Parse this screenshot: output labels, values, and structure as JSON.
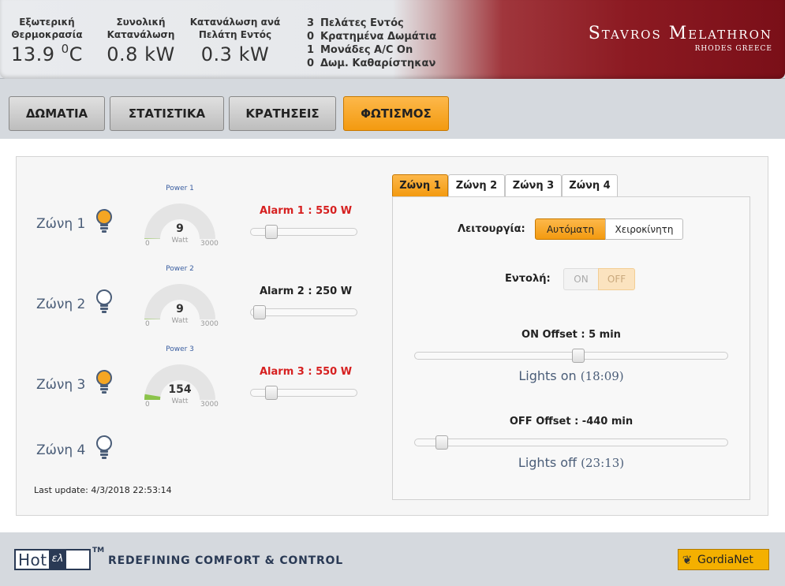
{
  "header": {
    "metrics": [
      {
        "label1": "Εξωτερική",
        "label2": "Θερμοκρασία",
        "value": "13.9 ",
        "sup": "0",
        "unit": "C"
      },
      {
        "label1": "Συνολική",
        "label2": "Κατανάλωση",
        "value": "0.8 kW"
      },
      {
        "label1": "Κατανάλωση ανά",
        "label2": "Πελάτη Εντός",
        "value": "0.3 kW"
      }
    ],
    "stats": [
      {
        "n": "3",
        "text": "Πελάτες Εντός"
      },
      {
        "n": "0",
        "text": "Κρατημένα Δωμάτια"
      },
      {
        "n": "1",
        "text": "Μονάδες A/C On"
      },
      {
        "n": "0",
        "text": "Δωμ. Καθαρίστηκαν"
      }
    ],
    "brand_name": "Stavros Melathron",
    "brand_sub": "RHODES GREECE"
  },
  "tabs": [
    "ΔΩΜΑΤΙΑ",
    "ΣΤΑΤΙΣΤΙΚΑ",
    "ΚΡΑΤΗΣΕΙΣ",
    "ΦΩΤΙΣΜΟΣ"
  ],
  "zones": [
    {
      "label": "Ζώνη 1",
      "lit": true,
      "gauge_title": "Power 1",
      "value": "9",
      "alarm": "Alarm 1 : 550 W",
      "alarm_red": true
    },
    {
      "label": "Ζώνη 2",
      "lit": false,
      "gauge_title": "Power 2",
      "value": "9",
      "alarm": "Alarm 2 : 250 W",
      "alarm_red": false
    },
    {
      "label": "Ζώνη 3",
      "lit": true,
      "gauge_title": "Power 3",
      "value": "154",
      "alarm": "Alarm 3 : 550 W",
      "alarm_red": true
    },
    {
      "label": "Ζώνη 4",
      "lit": false
    }
  ],
  "gauge_unit": "Watt",
  "gauge_min": "0",
  "gauge_max": "3000",
  "last_update": "Last update: 4/3/2018 22:53:14",
  "zone_tabs": [
    "Ζώνη 1",
    "Ζώνη 2",
    "Ζώνη 3",
    "Ζώνη 4"
  ],
  "control": {
    "mode_label": "Λειτουργία:",
    "mode_auto": "Αυτόματη",
    "mode_manual": "Χειροκίνητη",
    "command_label": "Εντολή:",
    "on": "ON",
    "off": "OFF",
    "on_offset_label": "ON Offset : 5 min",
    "lights_on": "Lights on ",
    "lights_on_time": "(18:09)",
    "off_offset_label": "OFF Offset : -440 min",
    "lights_off": "Lights off ",
    "lights_off_time": "(23:13)"
  },
  "footer": {
    "logo_a": "Hot",
    "logo_b": "ελ",
    "tm": "TM",
    "slogan": "REDEFINING COMFORT & CONTROL",
    "partner": "GordiaNet"
  },
  "colors": {
    "accent": "#f39a10",
    "brand": "#8c1a22",
    "alarm": "#d62020",
    "gauge_fill": "#8bc34a"
  }
}
